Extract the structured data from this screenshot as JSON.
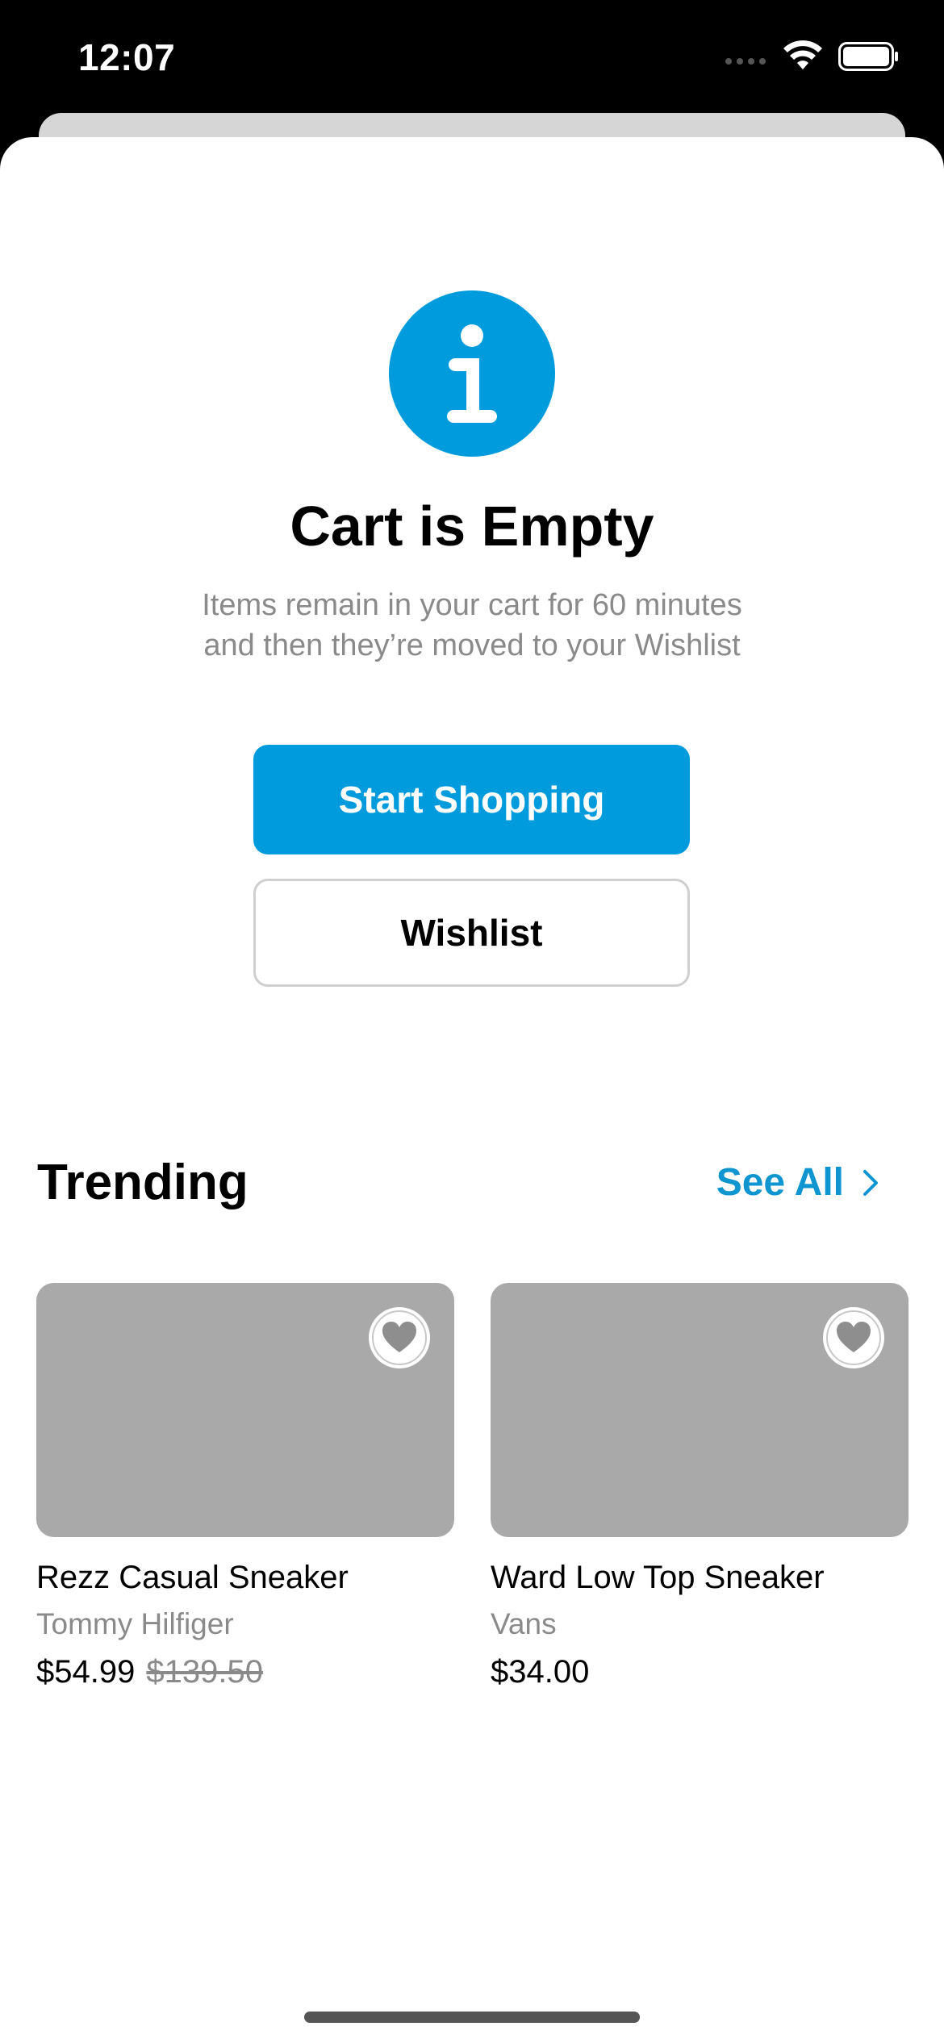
{
  "status_bar": {
    "time": "12:07"
  },
  "empty_state": {
    "icon": "info-icon",
    "title": "Cart is Empty",
    "description": "Items remain in your cart for 60 minutes and then they’re moved to your Wishlist",
    "primary_button": "Start Shopping",
    "secondary_button": "Wishlist"
  },
  "trending": {
    "title": "Trending",
    "see_all": "See All",
    "products": [
      {
        "name": "Rezz Casual Sneaker",
        "brand": "Tommy Hilfiger",
        "price": "$54.99",
        "old_price": "$139.50"
      },
      {
        "name": "Ward Low Top Sneaker",
        "brand": "Vans",
        "price": "$34.00",
        "old_price": ""
      }
    ]
  },
  "colors": {
    "accent": "#009BDC",
    "image_placeholder": "#A9A9A9",
    "secondary_text": "#8A8A8A"
  }
}
